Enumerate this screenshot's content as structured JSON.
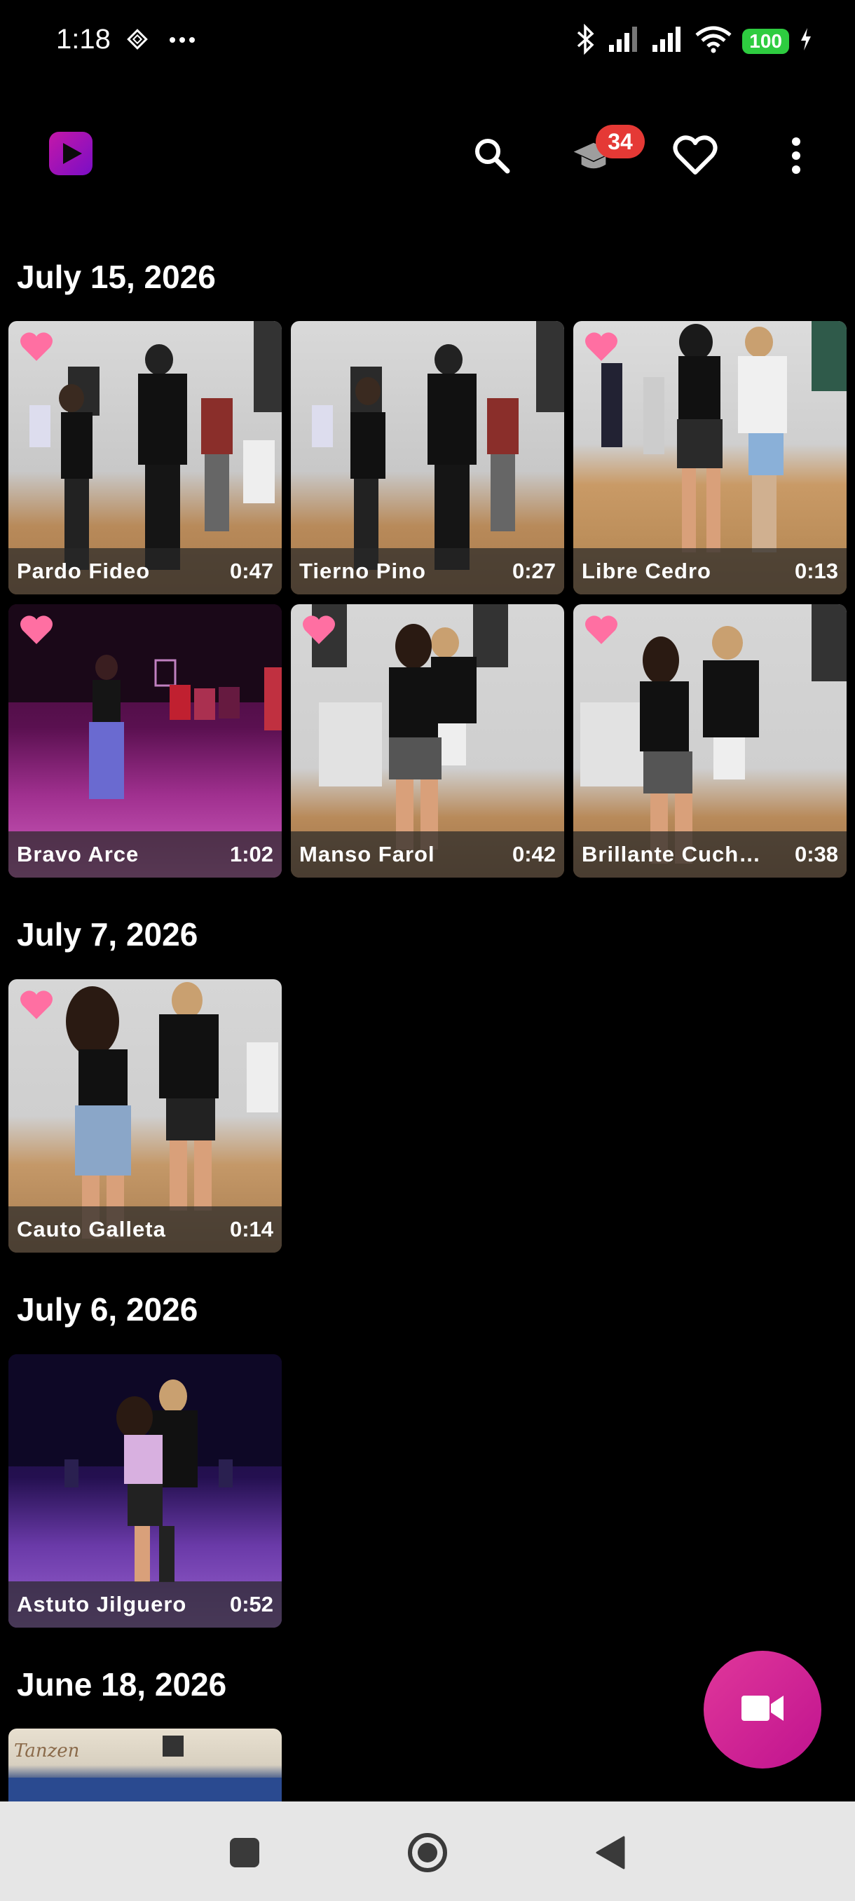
{
  "status_bar": {
    "time": "1:18",
    "battery": "100"
  },
  "app_bar": {
    "notification_count": "34"
  },
  "sections": [
    {
      "date": "July 15, 2026"
    },
    {
      "date": "July 7, 2026"
    },
    {
      "date": "July 6, 2026"
    },
    {
      "date": "June 18, 2026"
    }
  ],
  "videos": [
    {
      "title": "Pardo Fideo",
      "duration": "0:47",
      "favorite": true
    },
    {
      "title": "Tierno Pino",
      "duration": "0:27",
      "favorite": false
    },
    {
      "title": "Libre Cedro",
      "duration": "0:13",
      "favorite": true
    },
    {
      "title": "Bravo Arce",
      "duration": "1:02",
      "favorite": true
    },
    {
      "title": "Manso Farol",
      "duration": "0:42",
      "favorite": true
    },
    {
      "title": "Brillante Cuch…",
      "duration": "0:38",
      "favorite": true
    },
    {
      "title": "Cauto Galleta",
      "duration": "0:14",
      "favorite": true
    },
    {
      "title": "Astuto Jilguero",
      "duration": "0:52",
      "favorite": false
    }
  ],
  "colors": {
    "favorite_heart": "#ff6fa2",
    "fab": "#d8288f",
    "badge": "#e53935",
    "battery": "#2ecc40"
  },
  "icons": {
    "app_logo": "play-logo-icon",
    "search": "search-icon",
    "learn": "graduation-cap-icon",
    "favorites": "heart-outline-icon",
    "menu": "more-vert-icon",
    "fab": "video-camera-icon",
    "nav_recents": "square-icon",
    "nav_home": "circle-icon",
    "nav_back": "back-triangle-icon"
  }
}
